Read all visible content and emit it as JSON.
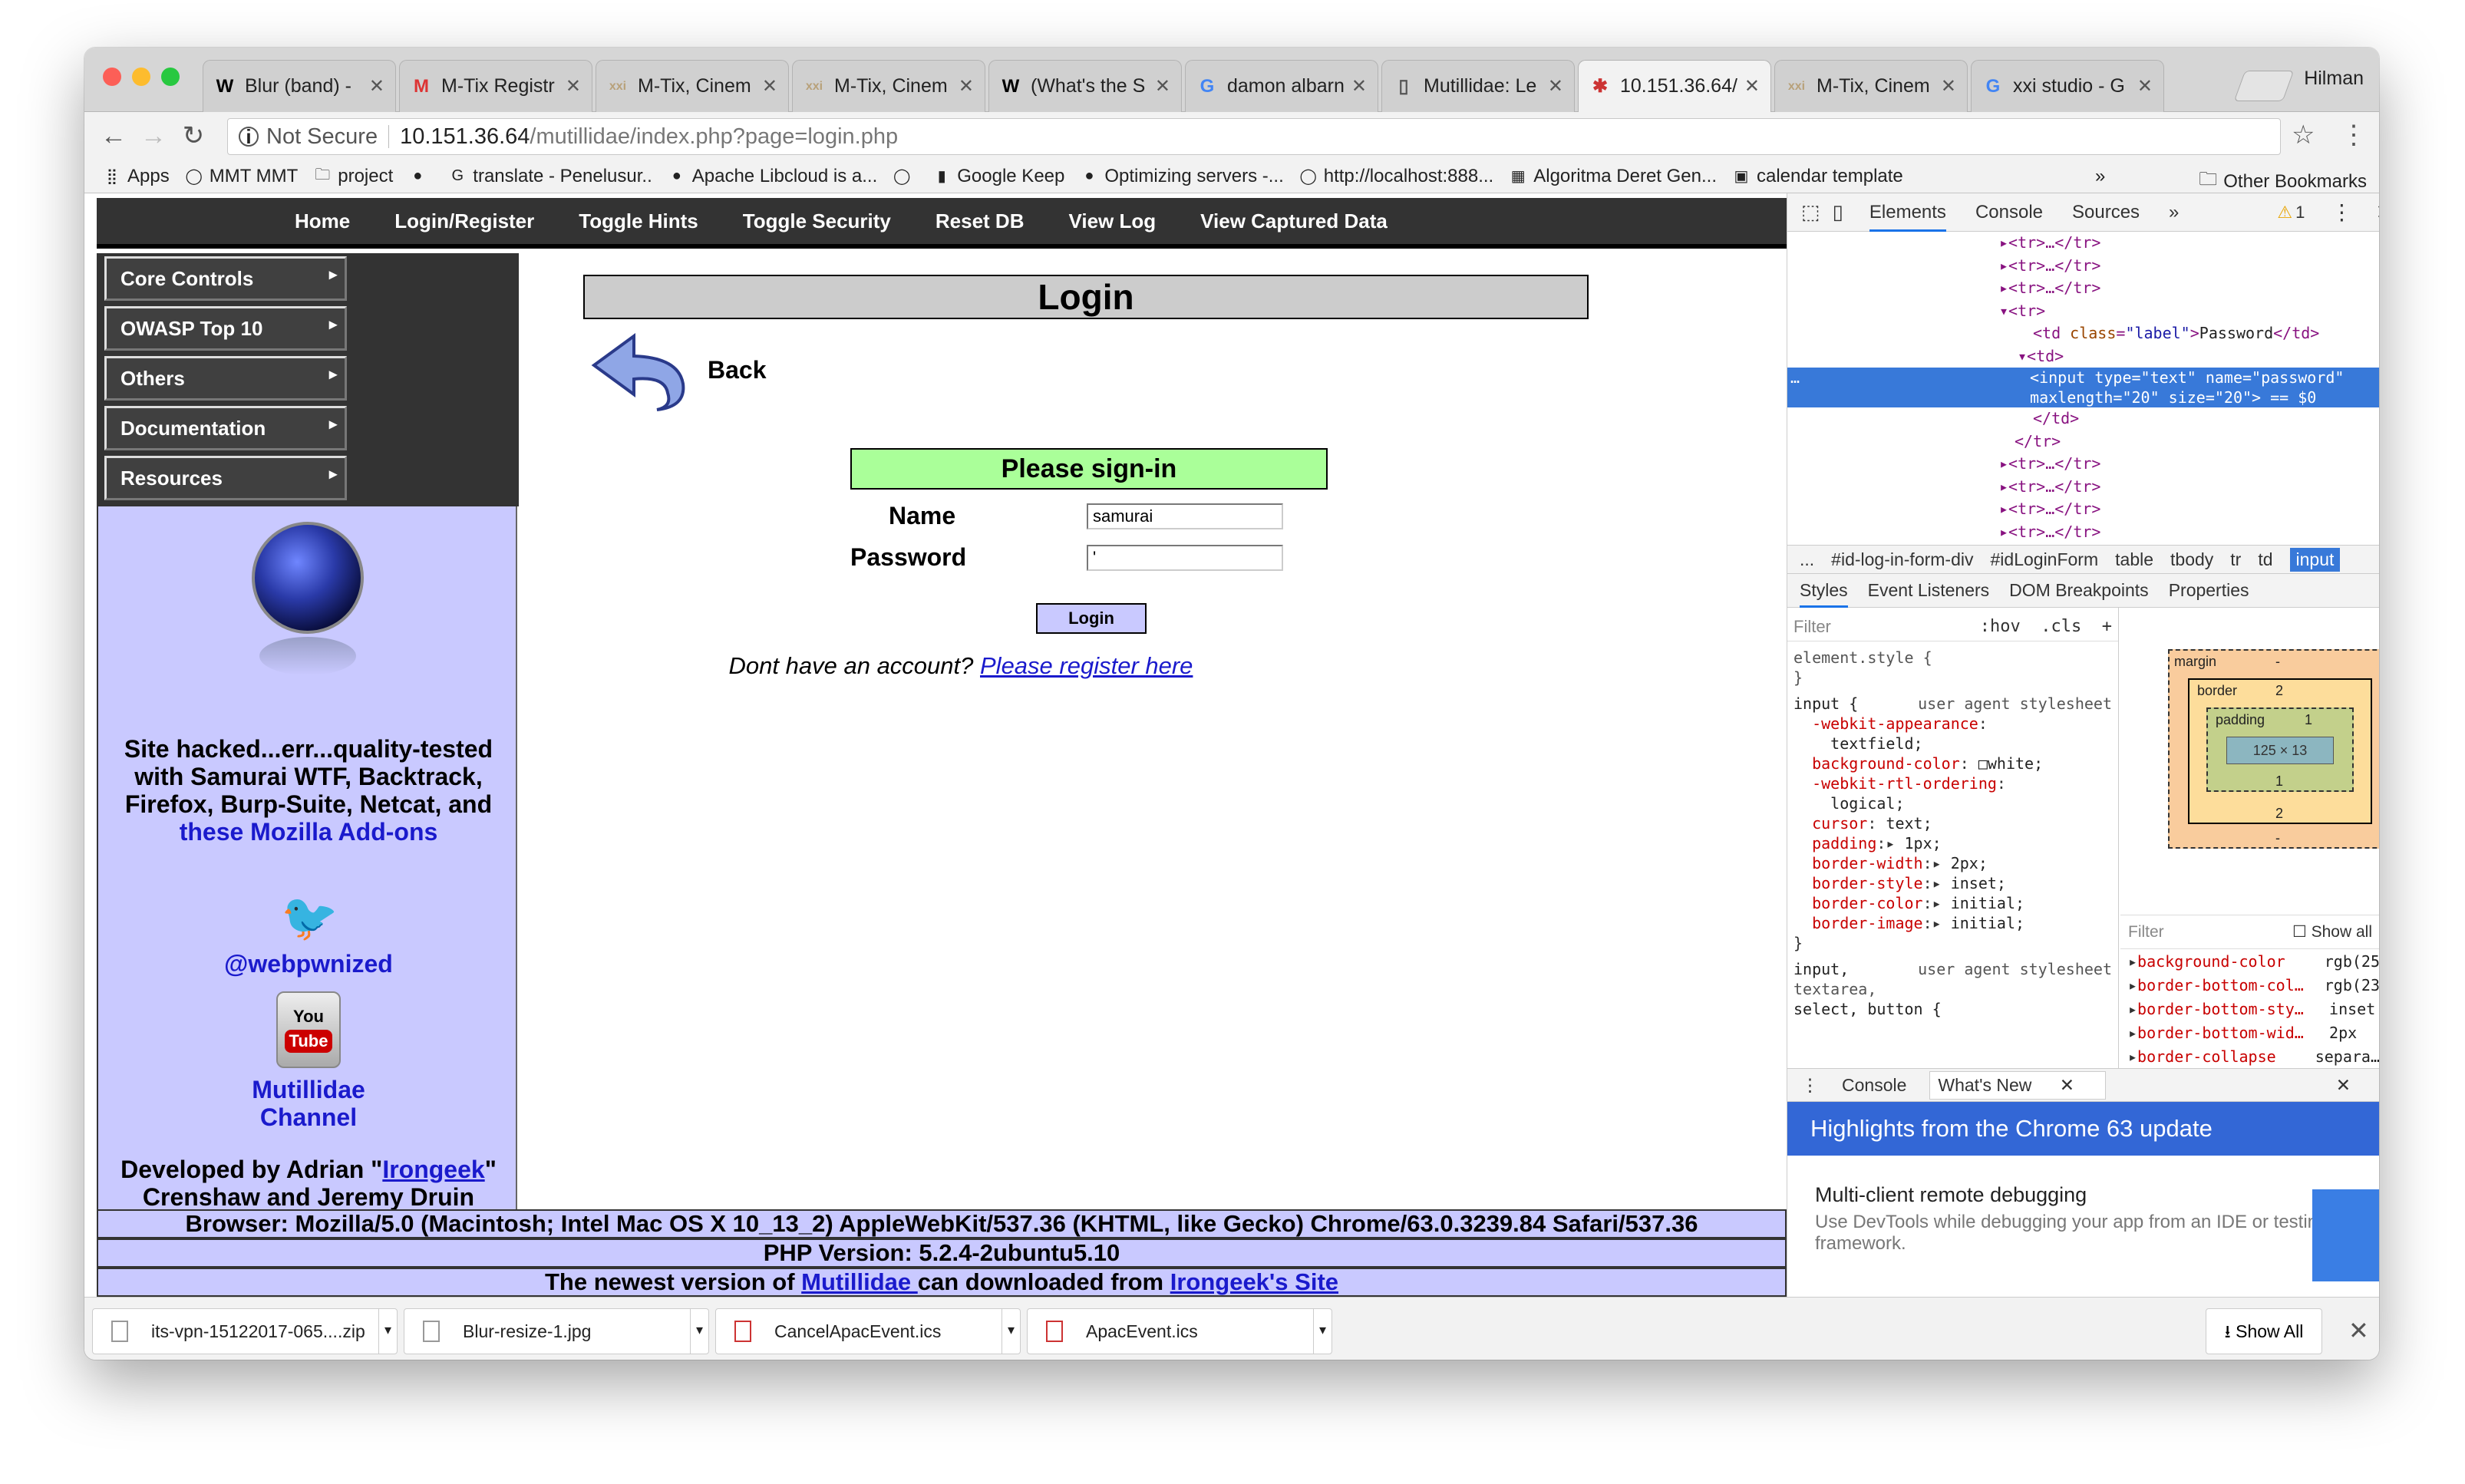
{
  "browser": {
    "tabs": [
      {
        "title": "Blur (band) -",
        "icon": "W"
      },
      {
        "title": "M-Tix Registr",
        "icon": "M"
      },
      {
        "title": "M-Tix, Cinem",
        "icon": "XXI"
      },
      {
        "title": "M-Tix, Cinem",
        "icon": "XXI"
      },
      {
        "title": "(What's the S",
        "icon": "W"
      },
      {
        "title": "damon albarn",
        "icon": "G"
      },
      {
        "title": "Mutillidae: Le",
        "icon": "doc"
      },
      {
        "title": "10.151.36.64/",
        "icon": "bug"
      },
      {
        "title": "M-Tix, Cinem",
        "icon": "XXI"
      },
      {
        "title": "xxi studio - G",
        "icon": "G"
      }
    ],
    "profile": "Hilman",
    "url_security": "Not Secure",
    "url_host": "10.151.36.64",
    "url_path": "/mutillidae/index.php?page=login.php",
    "bookmarks": [
      "Apps",
      "MMT MMT",
      "project",
      "",
      "translate - Penelusur..",
      "Apache Libcloud is a...",
      "",
      "Google Keep",
      "Optimizing servers -...",
      "http://localhost:888...",
      "Algoritma Deret Gen...",
      "calendar template"
    ],
    "bookmarks_more": "»",
    "other_bookmarks": "Other Bookmarks"
  },
  "site": {
    "nav": [
      "Home",
      "Login/Register",
      "Toggle Hints",
      "Toggle Security",
      "Reset DB",
      "View Log",
      "View Captured Data"
    ],
    "menu": [
      "Core Controls",
      "OWASP Top 10",
      "Others",
      "Documentation",
      "Resources"
    ],
    "sidebar": {
      "hacked_text": "Site hacked...err...quality-tested with Samurai WTF, Backtrack, Firefox, Burp-Suite, Netcat, and",
      "addons_link": "these Mozilla Add-ons",
      "twitter": "@webpwnized",
      "yt_you": "You",
      "yt_tube": "Tube",
      "channel": "Mutillidae Channel",
      "dev_prefix": "Developed by Adrian \"",
      "dev_link": "Irongeek",
      "dev_suffix": "\" Crenshaw and Jeremy Druin"
    },
    "login_title": "Login",
    "back": "Back",
    "signin_header": "Please sign-in",
    "name_label": "Name",
    "name_value": "samurai",
    "password_label": "Password",
    "password_value": "'",
    "login_button": "Login",
    "no_account": "Dont have an account? ",
    "register_link": "Please register here",
    "footer": {
      "browser": "Browser: Mozilla/5.0 (Macintosh; Intel Mac OS X 10_13_2) AppleWebKit/537.36 (KHTML, like Gecko) Chrome/63.0.3239.84 Safari/537.36",
      "php": "PHP Version: 5.2.4-2ubuntu5.10",
      "newest_prefix": "The newest version of ",
      "newest_link1": "Mutillidae ",
      "newest_mid": "can downloaded from ",
      "newest_link2": "Irongeek's Site"
    }
  },
  "devtools": {
    "tabs": [
      "Elements",
      "Console",
      "Sources",
      "»"
    ],
    "warnings": "1",
    "crumbs": [
      "...",
      "#id-log-in-form-div",
      "#idLoginForm",
      "table",
      "tbody",
      "tr",
      "td",
      "input"
    ],
    "subtabs": [
      "Styles",
      "Event Listeners",
      "DOM Breakpoints",
      "Properties"
    ],
    "filter": "Filter",
    "hov": ":hov",
    "cls": ".cls",
    "box": {
      "margin": "margin",
      "border": "border",
      "padding": "padding",
      "content": "125 × 13",
      "m_dash": "-",
      "b2": "2",
      "p1": "1"
    },
    "computed_filter": "Filter",
    "show_all": "Show all",
    "computed": [
      {
        "prop": "background-color",
        "val": "rgb(25"
      },
      {
        "prop": "border-bottom-col…",
        "val": "rgb(23"
      },
      {
        "prop": "border-bottom-sty…",
        "val": "inset"
      },
      {
        "prop": "border-bottom-wid…",
        "val": "2px"
      },
      {
        "prop": "border-collapse",
        "val": "separa…"
      }
    ],
    "drawer_console": "Console",
    "drawer_whatsnew": "What's New",
    "whatsnew_title": "Highlights from the Chrome 63 update",
    "whatsnew_item": "Multi-client remote debugging",
    "whatsnew_desc": "Use DevTools while debugging your app from an IDE or testing framework."
  },
  "downloads": {
    "items": [
      "its-vpn-15122017-065....zip",
      "Blur-resize-1.jpg",
      "CancelApacEvent.ics",
      "ApacEvent.ics"
    ],
    "show_all": "Show All"
  }
}
